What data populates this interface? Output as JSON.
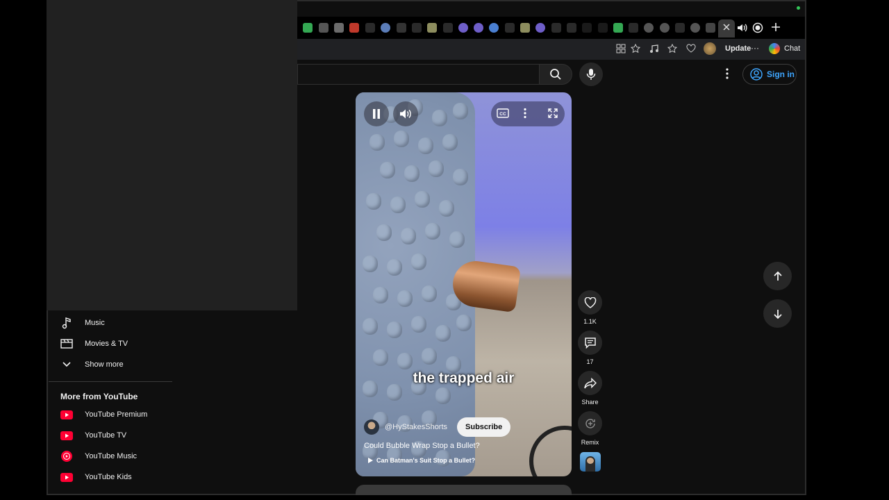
{
  "browser": {
    "toolbar": {
      "update_label": "Update",
      "chat_label": "Chat"
    }
  },
  "header": {
    "signin_label": "Sign in"
  },
  "sidebar": {
    "items": [
      {
        "label": "Music",
        "icon": "music-note-icon"
      },
      {
        "label": "Movies & TV",
        "icon": "clapperboard-icon"
      },
      {
        "label": "Show more",
        "icon": "chevron-down-icon"
      }
    ],
    "more_title": "More from YouTube",
    "more_items": [
      {
        "label": "YouTube Premium",
        "icon": "youtube-premium-icon"
      },
      {
        "label": "YouTube TV",
        "icon": "youtube-tv-icon"
      },
      {
        "label": "YouTube Music",
        "icon": "youtube-music-icon"
      },
      {
        "label": "YouTube Kids",
        "icon": "youtube-kids-icon"
      }
    ]
  },
  "short": {
    "caption": "the trapped air",
    "channel": "@HyStakesShorts",
    "subscribe_label": "Subscribe",
    "title": "Could Bubble Wrap Stop a Bullet?",
    "related": "Can Batman's Suit Stop a Bullet?"
  },
  "actions": {
    "likes": "1.1K",
    "comments": "17",
    "share": "Share",
    "remix": "Remix"
  },
  "colors": {
    "accent_link": "#3ea6ff",
    "youtube_red": "#ff0033",
    "background": "#0f0f0f"
  }
}
